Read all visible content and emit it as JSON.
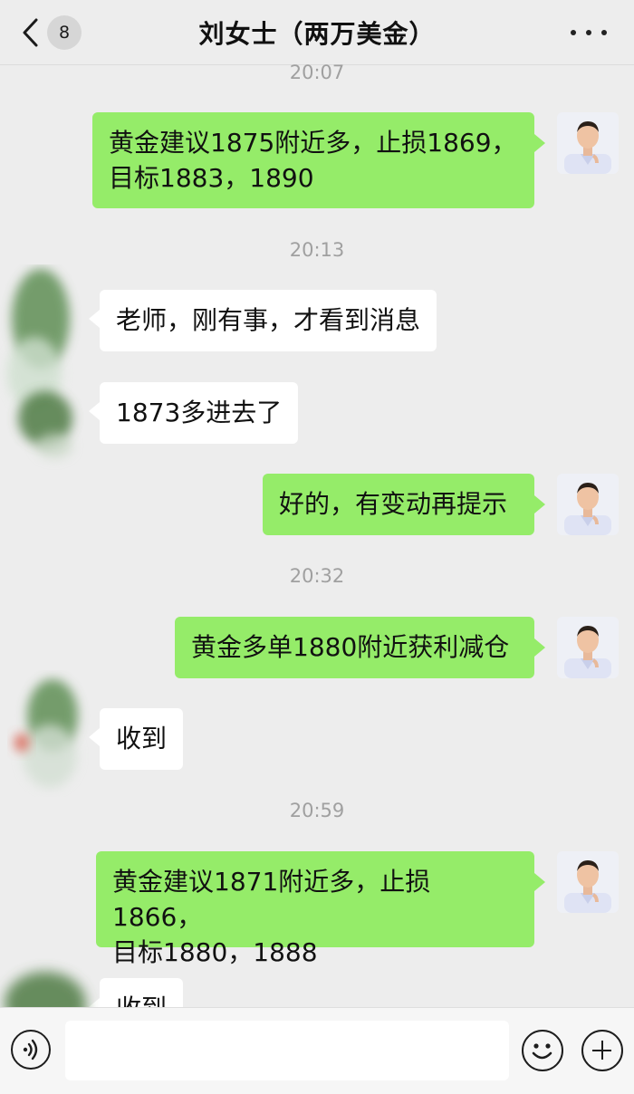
{
  "header": {
    "unread_count": "8",
    "title": "刘女士（两万美金）"
  },
  "messages": [
    {
      "type": "time",
      "text": "20:07"
    },
    {
      "type": "out",
      "line1": "黄金建议1875附近多，止损1869，",
      "line2": "目标1883，1890"
    },
    {
      "type": "time",
      "text": "20:13"
    },
    {
      "type": "in",
      "text": "老师，刚有事，才看到消息"
    },
    {
      "type": "in",
      "text": "1873多进去了"
    },
    {
      "type": "out",
      "text": "好的，有变动再提示"
    },
    {
      "type": "time",
      "text": "20:32"
    },
    {
      "type": "out",
      "text": "黄金多单1880附近获利减仓"
    },
    {
      "type": "in",
      "text": "收到"
    },
    {
      "type": "time",
      "text": "20:59"
    },
    {
      "type": "out",
      "line1": "黄金建议1871附近多，止损1866，",
      "line2": "目标1880，1888"
    },
    {
      "type": "in",
      "text": "收到"
    }
  ],
  "icons": {
    "back": "chevron-left-icon",
    "more": "more-dots-icon",
    "voice": "voice-icon",
    "emoji": "emoji-icon",
    "plus": "plus-icon"
  },
  "colors": {
    "outgoing_bubble": "#95ec69",
    "incoming_bubble": "#ffffff",
    "background": "#ededed"
  }
}
